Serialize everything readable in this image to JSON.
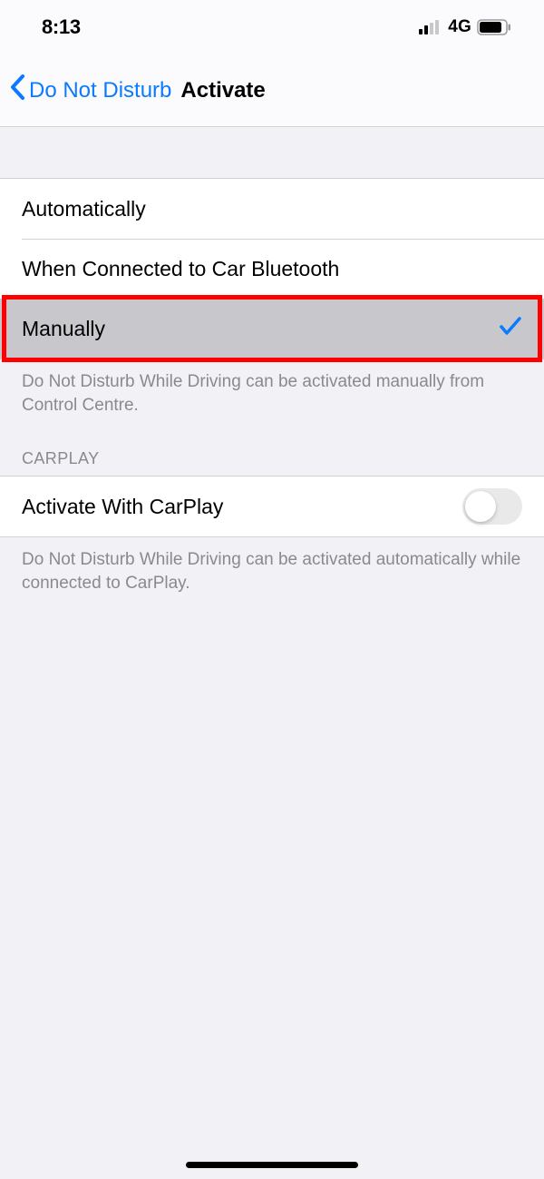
{
  "status_bar": {
    "time": "8:13",
    "network_label": "4G"
  },
  "nav": {
    "back_label": "Do Not Disturb",
    "title": "Activate"
  },
  "activation": {
    "options": [
      {
        "label": "Automatically",
        "selected": false
      },
      {
        "label": "When Connected to Car Bluetooth",
        "selected": false
      },
      {
        "label": "Manually",
        "selected": true
      }
    ],
    "footer": "Do Not Disturb While Driving can be activated manually from Control Centre."
  },
  "carplay": {
    "header": "CARPLAY",
    "toggle_label": "Activate With CarPlay",
    "toggle_on": false,
    "footer": "Do Not Disturb While Driving can be activated automatically while connected to CarPlay."
  }
}
